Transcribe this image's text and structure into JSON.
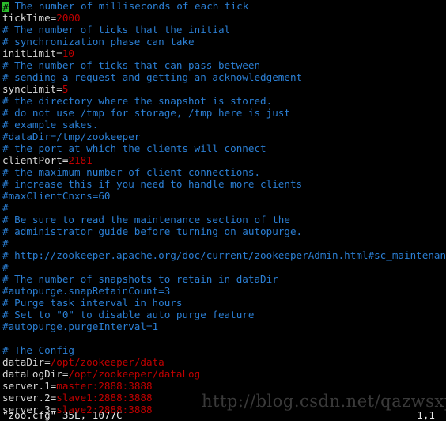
{
  "terminal": {
    "app": "vim",
    "colors": {
      "background": "#000000",
      "comment": "#2b7fd4",
      "key": "#d8d8d8",
      "value": "#c00000",
      "cursor": "#2bbd2b",
      "status_text": "#e6e6e6",
      "watermark": "#3a3a3a"
    },
    "cursor": {
      "char": "#",
      "line": 1,
      "column": 1
    }
  },
  "statusline": {
    "file": "\"zoo.cfg\" 35L, 1077C",
    "position": "1,1"
  },
  "watermark": {
    "text": "http://blog.csdn.net/qazwsxpcm"
  },
  "lines": [
    {
      "type": "comment",
      "cursor": "#",
      "text": " The number of milliseconds of each tick"
    },
    {
      "type": "assign",
      "key": "tickTime=",
      "value": "2000"
    },
    {
      "type": "comment",
      "text": "# The number of ticks that the initial"
    },
    {
      "type": "comment",
      "text": "# synchronization phase can take"
    },
    {
      "type": "assign",
      "key": "initLimit=",
      "value": "10"
    },
    {
      "type": "comment",
      "text": "# The number of ticks that can pass between"
    },
    {
      "type": "comment",
      "text": "# sending a request and getting an acknowledgement"
    },
    {
      "type": "assign",
      "key": "syncLimit=",
      "value": "5"
    },
    {
      "type": "comment",
      "text": "# the directory where the snapshot is stored."
    },
    {
      "type": "comment",
      "text": "# do not use /tmp for storage, /tmp here is just"
    },
    {
      "type": "comment",
      "text": "# example sakes."
    },
    {
      "type": "comment",
      "text": "#dataDir=/tmp/zookeeper"
    },
    {
      "type": "comment",
      "text": "# the port at which the clients will connect"
    },
    {
      "type": "assign",
      "key": "clientPort=",
      "value": "2181"
    },
    {
      "type": "comment",
      "text": "# the maximum number of client connections."
    },
    {
      "type": "comment",
      "text": "# increase this if you need to handle more clients"
    },
    {
      "type": "comment",
      "text": "#maxClientCnxns=60"
    },
    {
      "type": "comment",
      "text": "#"
    },
    {
      "type": "comment",
      "text": "# Be sure to read the maintenance section of the"
    },
    {
      "type": "comment",
      "text": "# administrator guide before turning on autopurge."
    },
    {
      "type": "comment",
      "text": "#"
    },
    {
      "type": "comment",
      "text": "# http://zookeeper.apache.org/doc/current/zookeeperAdmin.html#sc_maintenance"
    },
    {
      "type": "comment",
      "text": "#"
    },
    {
      "type": "comment",
      "text": "# The number of snapshots to retain in dataDir"
    },
    {
      "type": "comment",
      "text": "#autopurge.snapRetainCount=3"
    },
    {
      "type": "comment",
      "text": "# Purge task interval in hours"
    },
    {
      "type": "comment",
      "text": "# Set to \"0\" to disable auto purge feature"
    },
    {
      "type": "comment",
      "text": "#autopurge.purgeInterval=1"
    },
    {
      "type": "empty",
      "text": ""
    },
    {
      "type": "comment",
      "text": "# The Config"
    },
    {
      "type": "assign",
      "key": "dataDir=",
      "value": "/opt/zookeeper/data"
    },
    {
      "type": "assign",
      "key": "dataLogDir=",
      "value": "/opt/zookeeper/dataLog"
    },
    {
      "type": "assign",
      "key": "server.1=",
      "value": "master:2888:3888"
    },
    {
      "type": "assign",
      "key": "server.2=",
      "value": "slave1:2888:3888"
    },
    {
      "type": "assign",
      "key": "server.3=",
      "value": "slave2:2888:3888"
    }
  ]
}
